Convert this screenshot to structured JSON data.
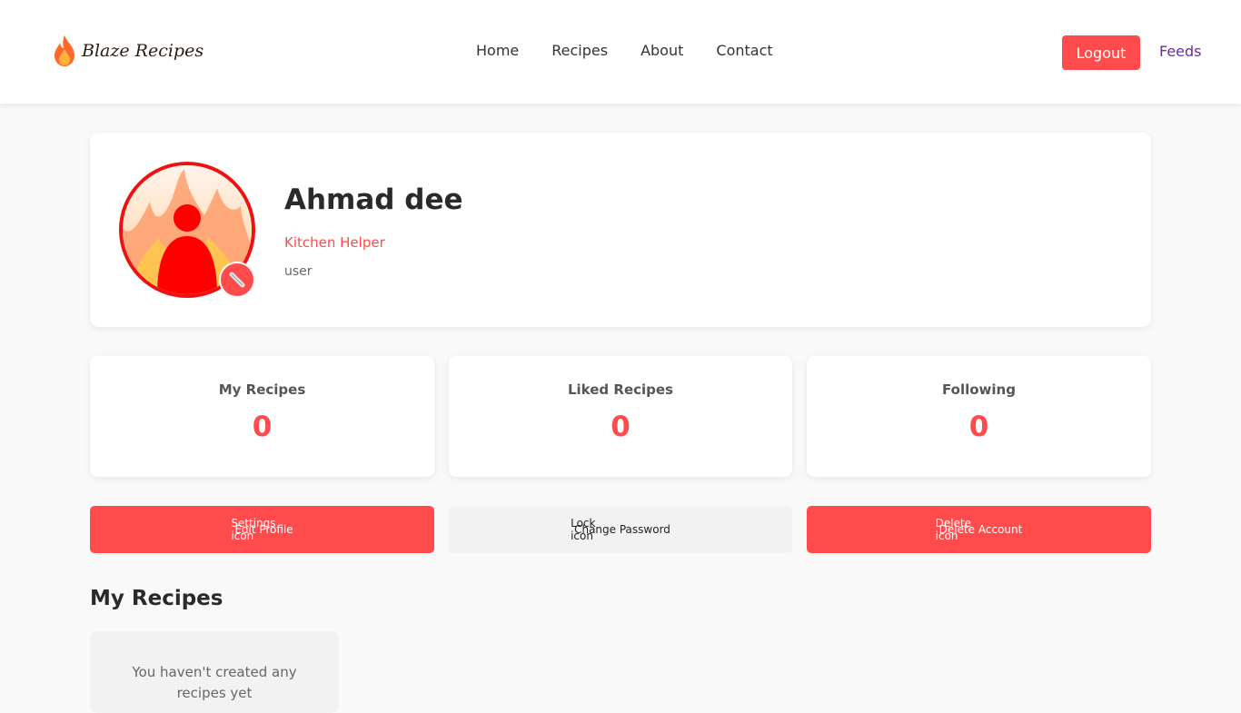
{
  "brand": {
    "name": "Blaze Recipes"
  },
  "nav": {
    "items": [
      {
        "label": "Home"
      },
      {
        "label": "Recipes"
      },
      {
        "label": "About"
      },
      {
        "label": "Contact"
      }
    ],
    "logout_label": "Logout",
    "feeds_label": "Feeds"
  },
  "profile": {
    "name": "Ahmad dee",
    "title": "Kitchen Helper",
    "role": "user"
  },
  "stats": [
    {
      "label": "My Recipes",
      "value": "0"
    },
    {
      "label": "Liked Recipes",
      "value": "0"
    },
    {
      "label": "Following",
      "value": "0"
    }
  ],
  "actions": [
    {
      "icon_alt": "Settings icon",
      "label": "Edit Profile"
    },
    {
      "icon_alt": "Lock icon",
      "label": "Change Password"
    },
    {
      "icon_alt": "Delete icon",
      "label": "Delete Account"
    }
  ],
  "recipes_section": {
    "title": "My Recipes",
    "empty_text": "You haven't created any recipes yet"
  },
  "colors": {
    "accent": "#ff4b4b",
    "feeds_link": "#6a2aa0"
  }
}
